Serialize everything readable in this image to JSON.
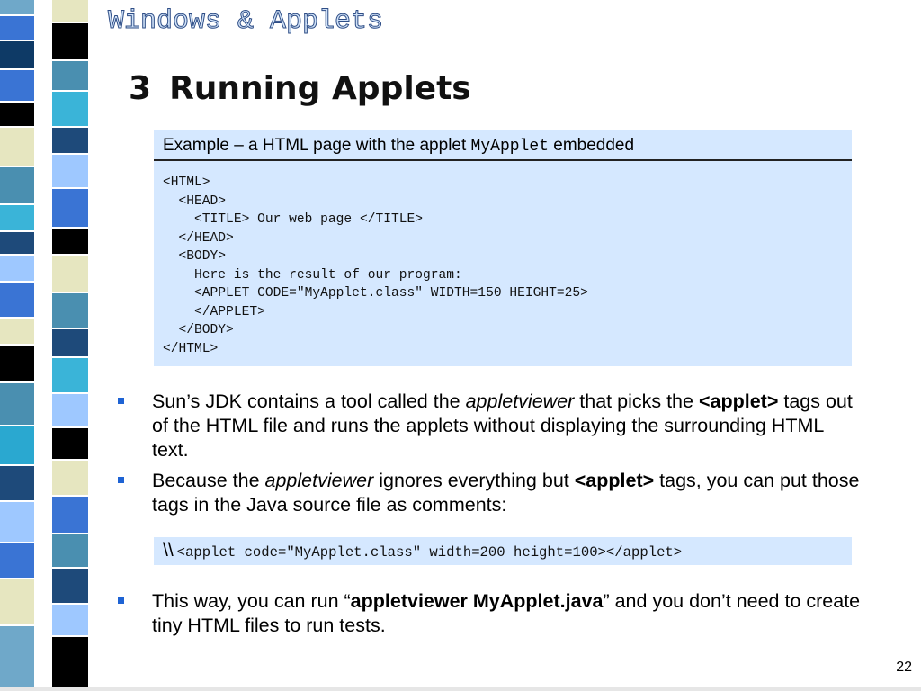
{
  "header": {
    "section_title": "Windows & Applets",
    "slide_number": "3",
    "slide_title": "Running Applets"
  },
  "example": {
    "caption_prefix": "Example – a HTML page with the applet ",
    "caption_code": "MyApplet",
    "caption_suffix": " embedded",
    "code": "<HTML>\n  <HEAD>\n    <TITLE> Our web page </TITLE>\n  </HEAD>\n  <BODY>\n    Here is the result of our program:\n    <APPLET CODE=\"MyApplet.class\" WIDTH=150 HEIGHT=25>\n    </APPLET>\n  </BODY>\n</HTML>"
  },
  "bullets": {
    "b1": {
      "t1": "Sun’s JDK contains a tool called the ",
      "t2": "appletviewer",
      "t3": " that picks the ",
      "t4": "<applet>",
      "t5": " tags out of the HTML file and runs the applets without displaying the surrounding HTML text."
    },
    "b2": {
      "t1": "Because the ",
      "t2": "appletviewer",
      "t3": " ignores everything but ",
      "t4": "<applet>",
      "t5": " tags, you can put those tags in the Java source file as comments:"
    },
    "b3": {
      "t1": "This way, you can run “",
      "t2": "appletviewer MyApplet.java",
      "t3": "” and you don’t need to create tiny HTML files to run tests."
    }
  },
  "comment": {
    "prefix": "\\\\",
    "code": "<applet code=\"MyApplet.class\" width=200 height=100></applet>"
  },
  "footer": {
    "page_number": "22"
  },
  "colors": {
    "strip_a": [
      "#6fa8c9",
      "#3a74d4",
      "#0e3a66",
      "#3a74d4",
      "#000000",
      "#e6e6c0",
      "#4a8fb0",
      "#3ab4d8",
      "#1e4a7a",
      "#9ec8ff",
      "#3a74d4",
      "#e6e6c0",
      "#000000",
      "#4a8fb0",
      "#2aa8d0",
      "#1e4a7a",
      "#9ec8ff",
      "#3a74d4",
      "#e6e6c0",
      "#6fa8c9"
    ],
    "strip_b": [
      "#e6e6c0",
      "#000000",
      "#4a8fb0",
      "#3ab4d8",
      "#1e4a7a",
      "#9ec8ff",
      "#3a74d4",
      "#000000",
      "#e6e6c0",
      "#4a8fb0",
      "#1e4a7a",
      "#3ab4d8",
      "#9ec8ff",
      "#000000",
      "#e6e6c0",
      "#3a74d4",
      "#4a8fb0",
      "#1e4a7a",
      "#9ec8ff",
      "#000000"
    ],
    "bullet_marker": "#1e63d4",
    "box_background": "#d5e8ff"
  }
}
